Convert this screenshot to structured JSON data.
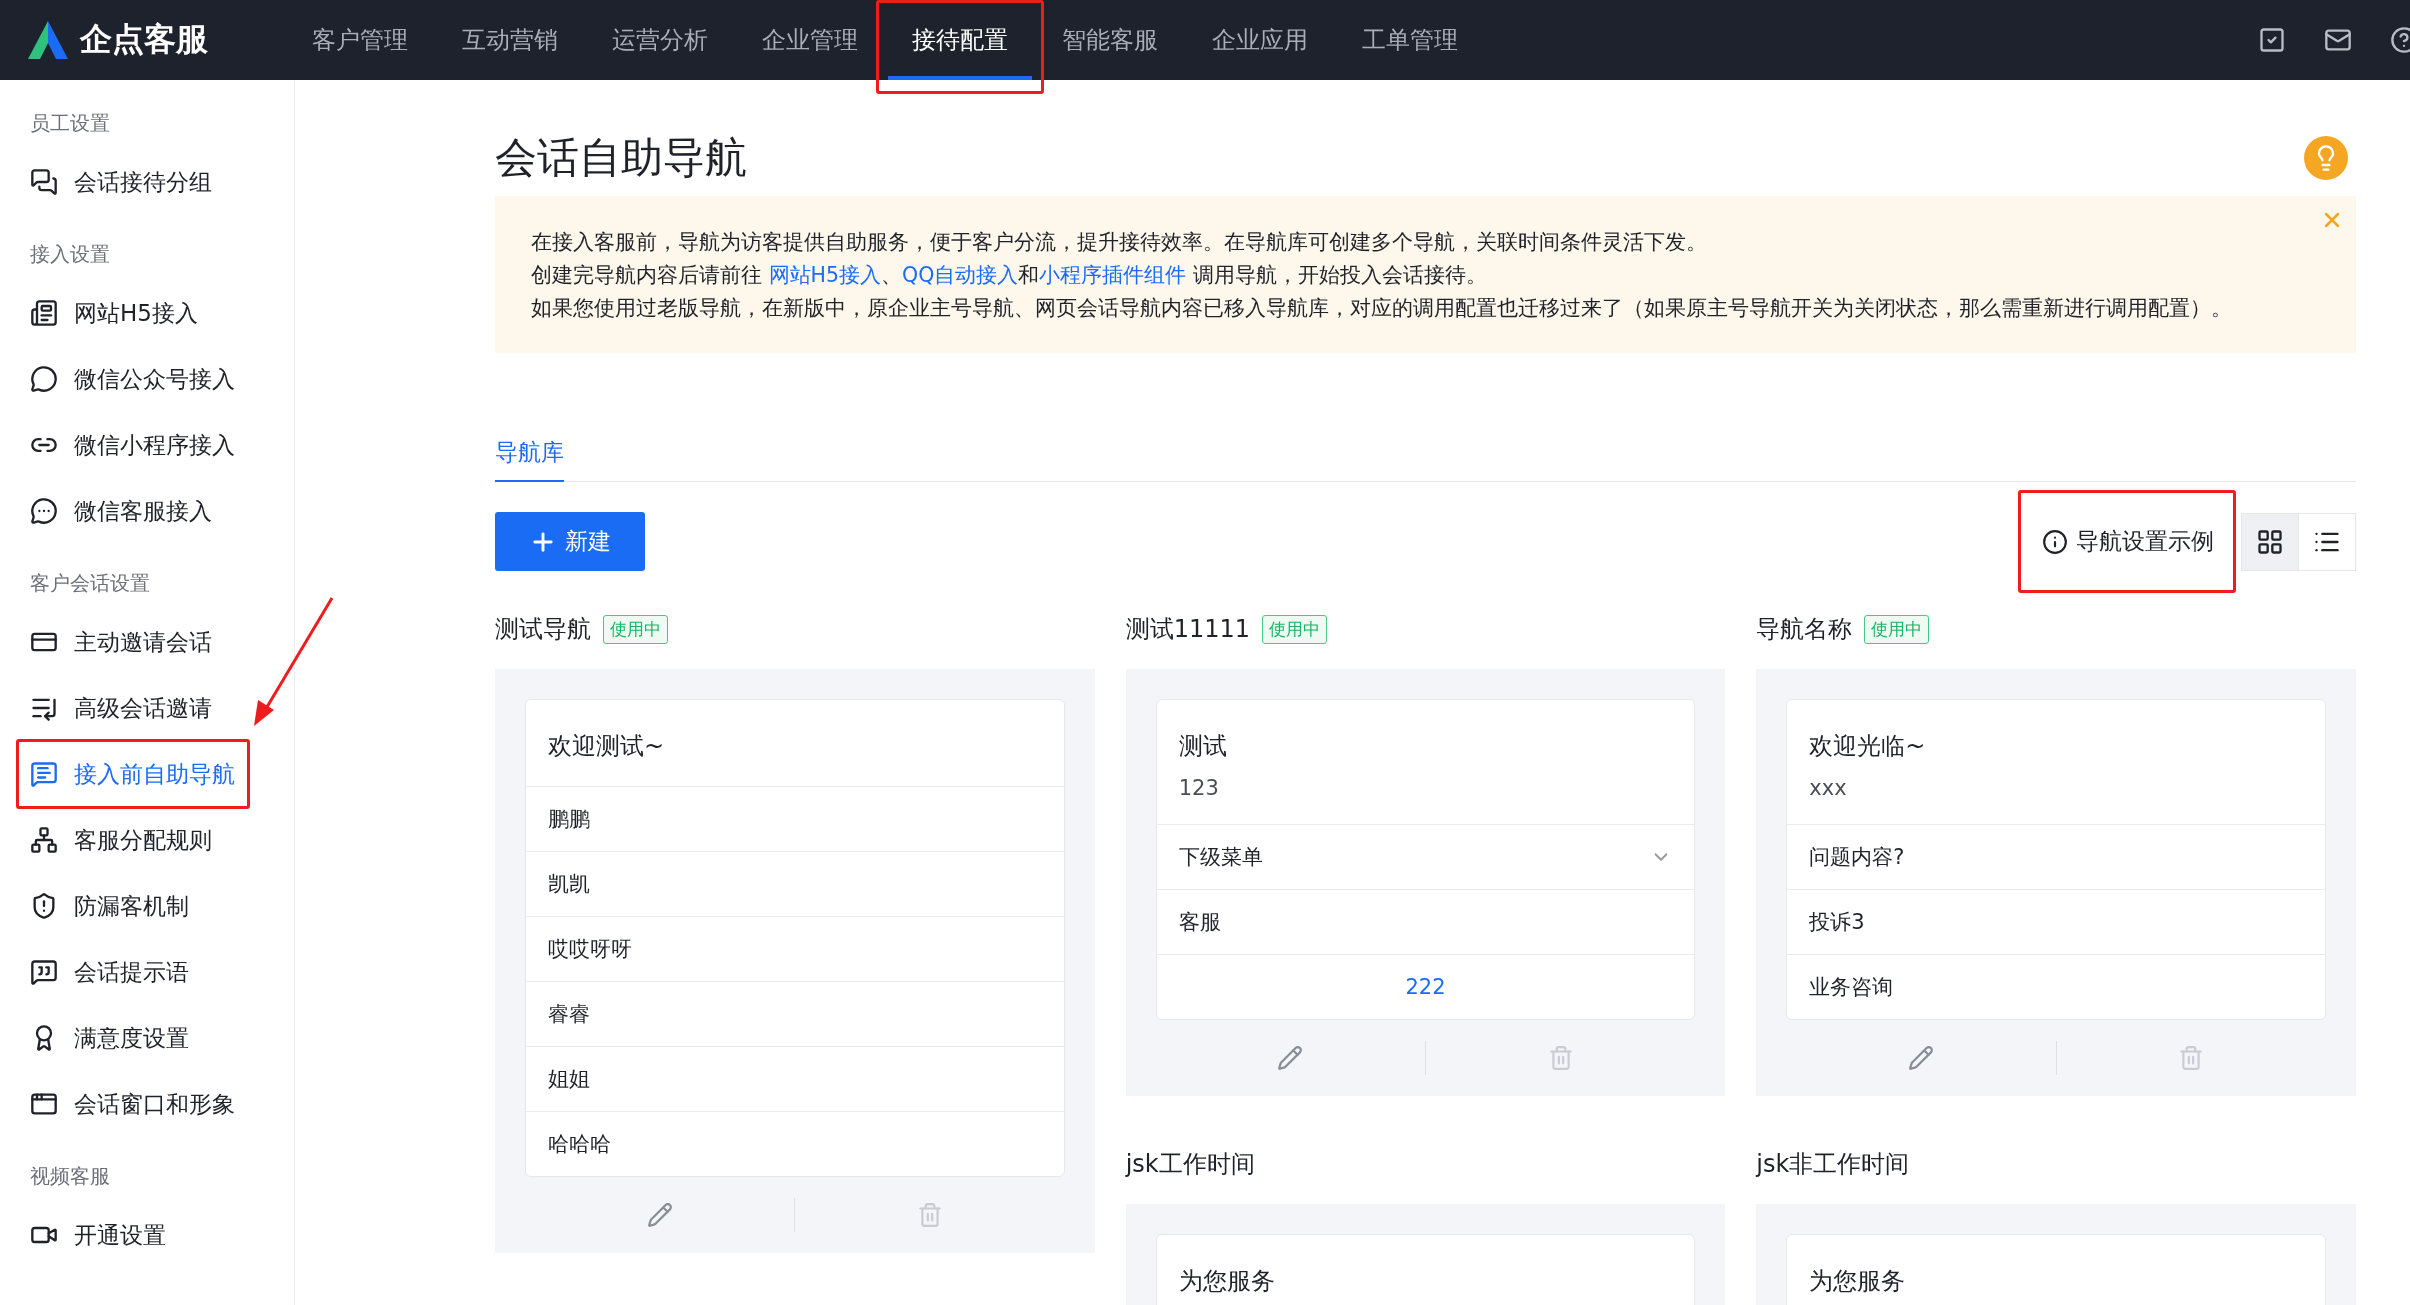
{
  "brand": {
    "name": "企点客服"
  },
  "top_nav": [
    {
      "label": "客户管理",
      "selected": false
    },
    {
      "label": "互动营销",
      "selected": false
    },
    {
      "label": "运营分析",
      "selected": false
    },
    {
      "label": "企业管理",
      "selected": false
    },
    {
      "label": "接待配置",
      "selected": true
    },
    {
      "label": "智能客服",
      "selected": false
    },
    {
      "label": "企业应用",
      "selected": false
    },
    {
      "label": "工单管理",
      "selected": false
    }
  ],
  "sidebar": {
    "groups": [
      {
        "heading": "员工设置",
        "items": [
          {
            "label": "会话接待分组",
            "selected": false
          }
        ]
      },
      {
        "heading": "接入设置",
        "items": [
          {
            "label": "网站H5接入",
            "selected": false
          },
          {
            "label": "微信公众号接入",
            "selected": false
          },
          {
            "label": "微信小程序接入",
            "selected": false
          },
          {
            "label": "微信客服接入",
            "selected": false
          }
        ]
      },
      {
        "heading": "客户会话设置",
        "items": [
          {
            "label": "主动邀请会话",
            "selected": false
          },
          {
            "label": "高级会话邀请",
            "selected": false
          },
          {
            "label": "接入前自助导航",
            "selected": true
          },
          {
            "label": "客服分配规则",
            "selected": false
          },
          {
            "label": "防漏客机制",
            "selected": false
          },
          {
            "label": "会话提示语",
            "selected": false
          },
          {
            "label": "满意度设置",
            "selected": false
          },
          {
            "label": "会话窗口和形象",
            "selected": false
          }
        ]
      },
      {
        "heading": "视频客服",
        "items": [
          {
            "label": "开通设置",
            "selected": false
          }
        ]
      }
    ]
  },
  "page": {
    "title": "会话自助导航"
  },
  "notice": {
    "lines": [
      [
        {
          "kind": "text",
          "text": "在接入客服前，导航为访客提供自助服务，便于客户分流，提升接待效率。在导航库可创建多个导航，关联时间条件灵活下发。"
        }
      ],
      [
        {
          "kind": "text",
          "text": "创建完导航内容后请前往 "
        },
        {
          "kind": "link",
          "text": "网站H5接入"
        },
        {
          "kind": "text",
          "text": "、"
        },
        {
          "kind": "link",
          "text": "QQ自动接入"
        },
        {
          "kind": "text",
          "text": "和"
        },
        {
          "kind": "link",
          "text": "小程序插件组件"
        },
        {
          "kind": "text",
          "text": " 调用导航，开始投入会话接待。"
        }
      ],
      [
        {
          "kind": "text",
          "text": "如果您使用过老版导航，在新版中，原企业主号导航、网页会话导航内容已移入导航库，对应的调用配置也迁移过来了（如果原主号导航开关为关闭状态，那么需重新进行调用配置）。"
        }
      ]
    ]
  },
  "tabs": [
    {
      "label": "导航库",
      "selected": true
    }
  ],
  "new_button": {
    "label": "新建"
  },
  "example_link": {
    "label": "导航设置示例"
  },
  "view_toggle": [
    {
      "kind": "grid",
      "selected": true
    },
    {
      "kind": "list",
      "selected": false
    }
  ],
  "columns": [
    [
      {
        "name": "测试导航",
        "status": "使用中",
        "greeting": "欢迎测试~",
        "actions": true,
        "items": [
          {
            "kind": "item",
            "label": "鹏鹏"
          },
          {
            "kind": "item",
            "label": "凯凯"
          },
          {
            "kind": "item",
            "label": "哎哎呀呀"
          },
          {
            "kind": "item",
            "label": "睿睿"
          },
          {
            "kind": "item",
            "label": "姐姐"
          },
          {
            "kind": "item",
            "label": "哈哈哈"
          }
        ]
      }
    ],
    [
      {
        "name": "测试11111",
        "status": "使用中",
        "greeting": "测试",
        "subtitle": "123",
        "actions": true,
        "items": [
          {
            "kind": "submenu",
            "label": "下级菜单"
          },
          {
            "kind": "item",
            "label": "客服"
          },
          {
            "kind": "button",
            "label": "222"
          }
        ]
      },
      {
        "name": "jsk工作时间",
        "greeting": "为您服务",
        "actions": false
      }
    ],
    [
      {
        "name": "导航名称",
        "status": "使用中",
        "greeting": "欢迎光临~",
        "subtitle": "xxx",
        "actions": true,
        "items": [
          {
            "kind": "item",
            "label": "问题内容?"
          },
          {
            "kind": "item",
            "label": "投诉3"
          },
          {
            "kind": "item",
            "label": "业务咨询"
          }
        ]
      },
      {
        "name": "jsk非工作时间",
        "greeting": "为您服务",
        "actions": false
      }
    ]
  ]
}
